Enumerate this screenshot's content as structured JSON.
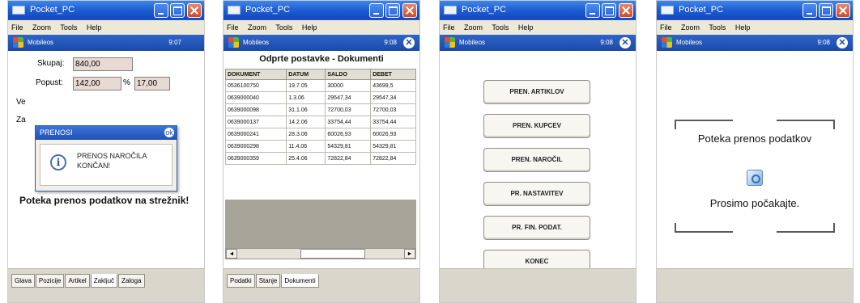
{
  "window": {
    "title": "Pocket_PC",
    "menu": [
      "File",
      "Zoom",
      "Tools",
      "Help"
    ]
  },
  "device": {
    "app_name": "Mobileos",
    "status_1": "9:07",
    "status_2": "9:08",
    "ok_glyph": "✕"
  },
  "panel1": {
    "labels": {
      "skupaj": "Skupaj:",
      "popust": "Popust:",
      "percent": "%",
      "ve": "Ve",
      "za": "Za"
    },
    "values": {
      "skupaj": "840,00",
      "popust": "142,00",
      "popust_pct": "17,00"
    },
    "dialog": {
      "title": "PRENOSI",
      "close": "ok",
      "icon": "i",
      "message": "PRENOS NAROČILA KONČAN!"
    },
    "message": "Poteka prenos podatkov na strežnik!",
    "tabs": [
      "Glava",
      "Pozicije",
      "Artikel",
      "Zaključ",
      "Zaloga"
    ],
    "active_tab": "Zaključ"
  },
  "panel2": {
    "title": "Odprte postavke - Dokumenti",
    "columns": [
      "DOKUMENT",
      "DATUM",
      "SALDO",
      "DEBET"
    ],
    "rows": [
      [
        "0536100750",
        "19.7.05",
        "30000",
        "43699,5"
      ],
      [
        "0639000040",
        "1.3.06",
        "29547,34",
        "29547,34"
      ],
      [
        "0639000098",
        "31.1.06",
        "72700,03",
        "72700,03"
      ],
      [
        "0639000137",
        "14.2.06",
        "33754,44",
        "33754,44"
      ],
      [
        "0639000241",
        "28.3.06",
        "60026,93",
        "60026,93"
      ],
      [
        "0639000298",
        "11.4.06",
        "54329,81",
        "54329,81"
      ],
      [
        "0639000359",
        "25.4.06",
        "72822,84",
        "72822,84"
      ]
    ],
    "scroll_left": "◄",
    "scroll_right": "►",
    "tabs": [
      "Podatki",
      "Stanje",
      "Dokumenti"
    ],
    "active_tab": "Dokumenti"
  },
  "panel3": {
    "buttons": [
      "PREN. ARTIKLOV",
      "PREN. KUPCEV",
      "PREN. NAROČIL",
      "PR. NASTAVITEV",
      "PR. FIN. PODAT.",
      "KONEC"
    ]
  },
  "panel4": {
    "line1": "Poteka prenos podatkov",
    "line2": "Prosimo počakajte."
  }
}
